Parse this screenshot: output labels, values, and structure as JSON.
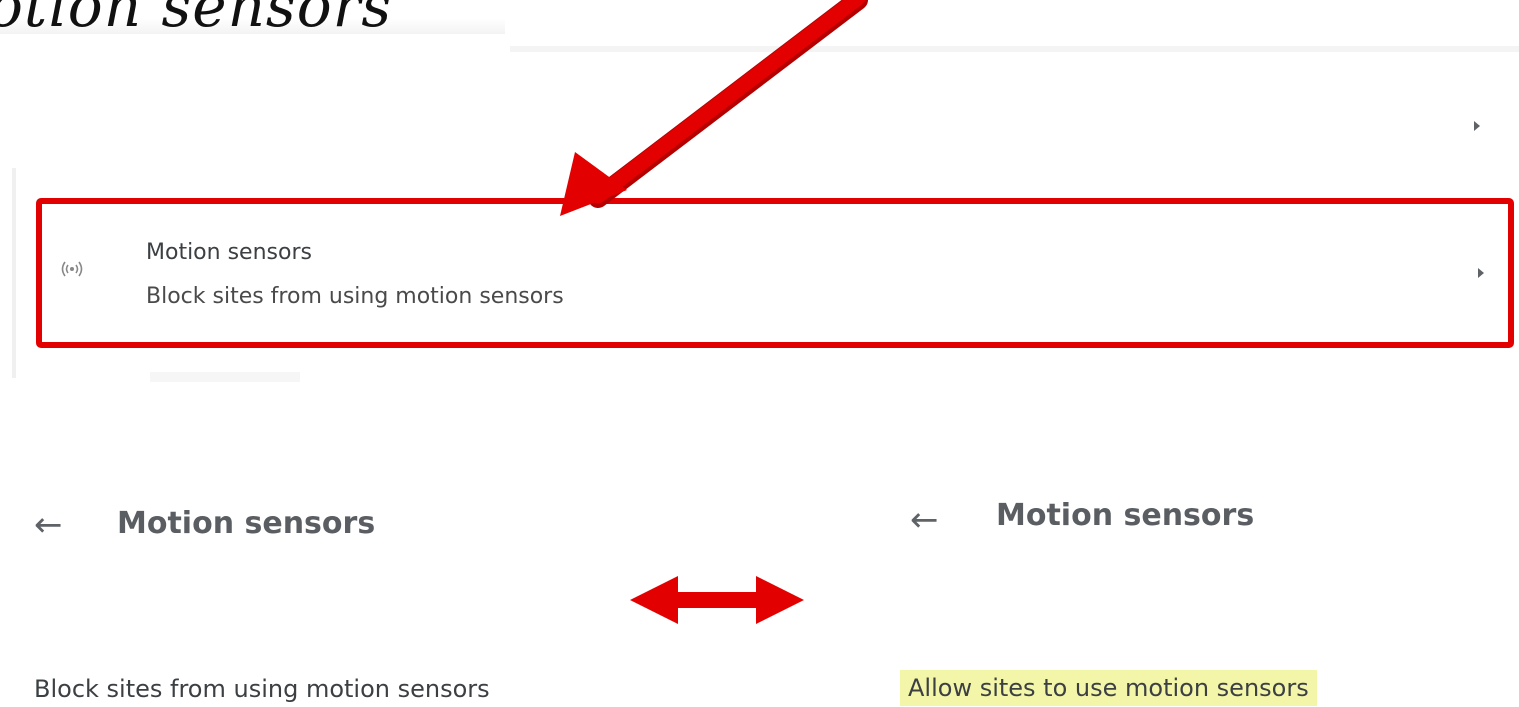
{
  "heading": {
    "text": "otion sensors"
  },
  "settings_row": {
    "title": "Motion sensors",
    "subtitle": "Block sites from using motion sensors",
    "icon": "motion-sensor-icon"
  },
  "left_page": {
    "back_icon": "←",
    "title": "Motion sensors",
    "setting_label": "Block sites from using motion sensors"
  },
  "right_page": {
    "back_icon": "←",
    "title": "Motion sensors",
    "setting_label": "Allow sites to use motion sensors"
  },
  "colors": {
    "highlight_border": "#e30000",
    "arrow": "#e30000",
    "highlight_background": "#f3f6a8"
  }
}
